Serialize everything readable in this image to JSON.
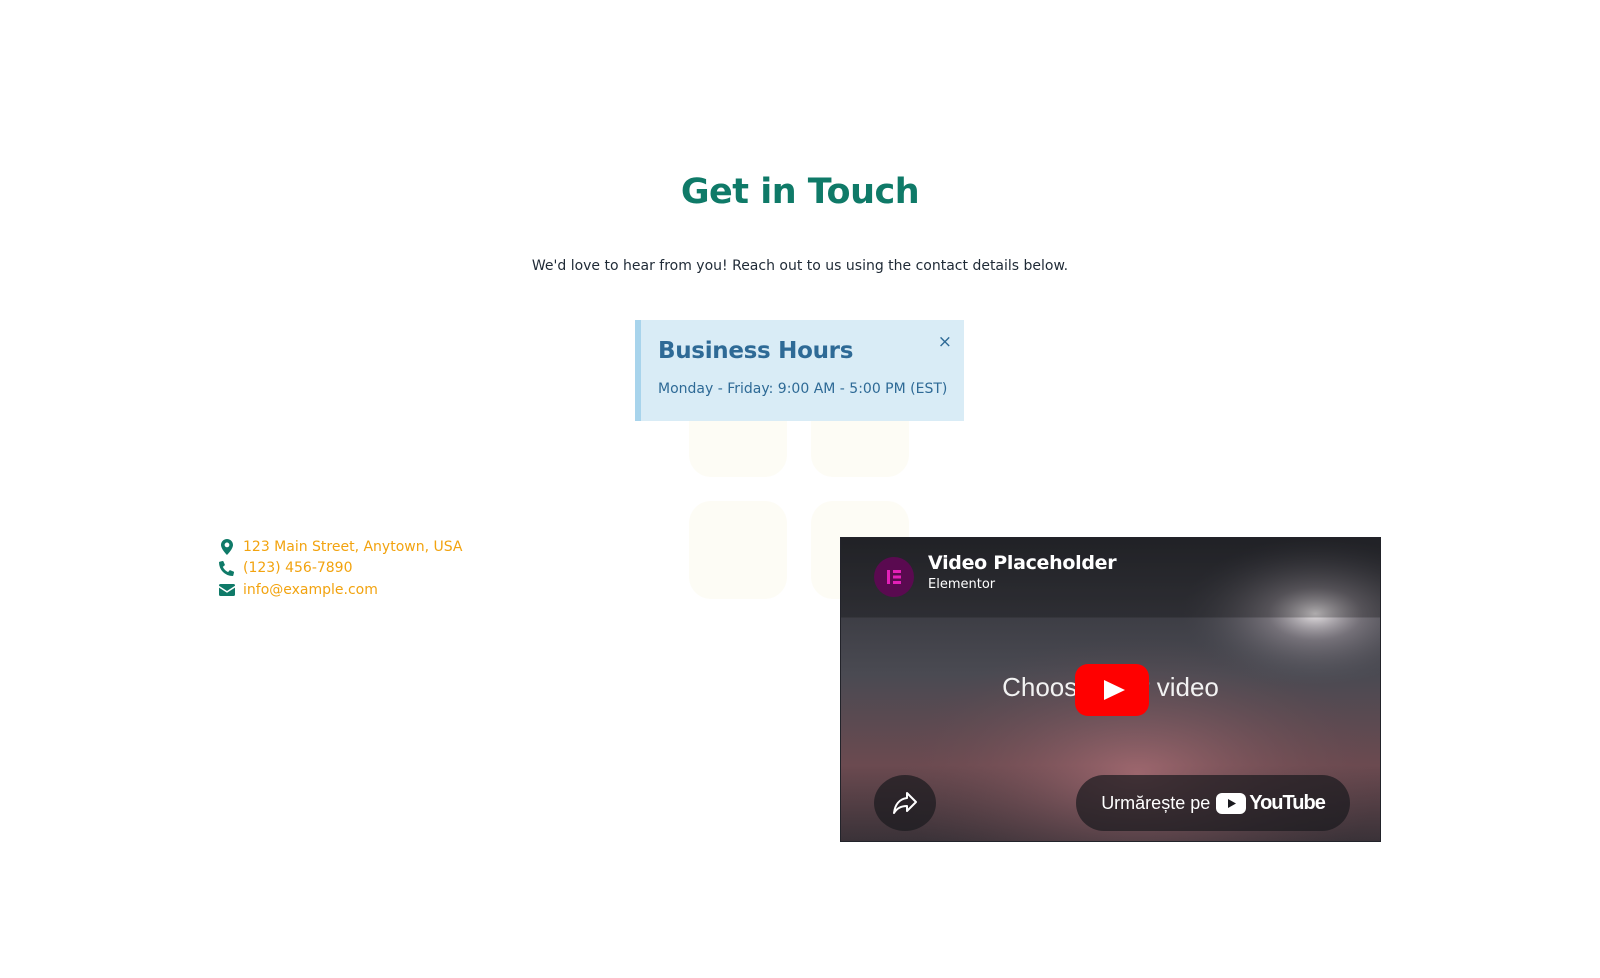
{
  "colors": {
    "heading": "#0f7a68",
    "body_text": "#1f2a36",
    "link": "#f2a30f",
    "icon": "#0f7a68",
    "alert_bg": "#d9ecf6",
    "alert_border": "#a8d4ec",
    "alert_text": "#2e6a96",
    "youtube_red": "#ff0000",
    "elementor_pink": "#e320b8"
  },
  "header": {
    "title": "Get in Touch",
    "subtitle": "We'd love to hear from you! Reach out to us using the contact details below."
  },
  "alert": {
    "title": "Business Hours",
    "text": "Monday - Friday: 9:00 AM - 5:00 PM (EST)",
    "close_label": "×"
  },
  "contact": {
    "items": [
      {
        "icon": "map-marker-icon",
        "text": "123 Main Street, Anytown, USA"
      },
      {
        "icon": "phone-icon",
        "text": "(123) 456-7890"
      },
      {
        "icon": "envelope-icon",
        "text": "info@example.com"
      }
    ]
  },
  "video": {
    "title": "Video Placeholder",
    "channel": "Elementor",
    "center_text": "Choose your video",
    "watch_label": "Urmărește pe",
    "watch_brand": "YouTube"
  }
}
